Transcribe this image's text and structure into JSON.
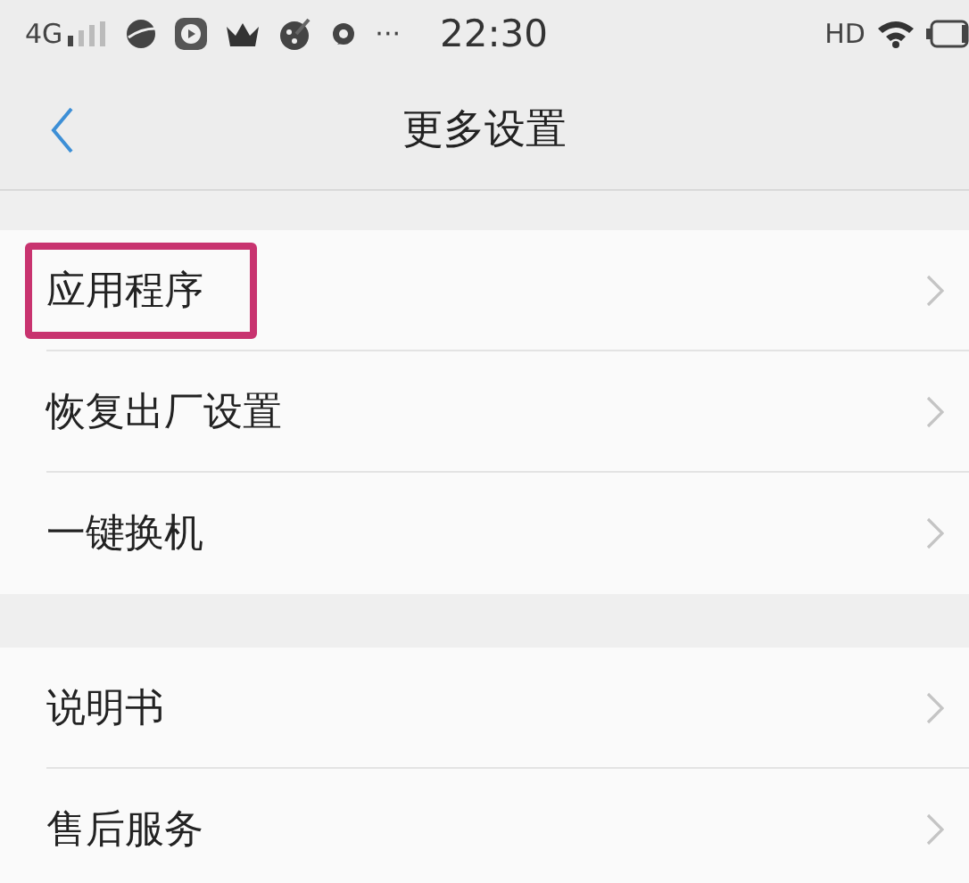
{
  "status_bar": {
    "network": "4G",
    "more": "···",
    "time": "22:30",
    "hd": "HD"
  },
  "header": {
    "title": "更多设置"
  },
  "sections": [
    {
      "items": [
        {
          "label": "应用程序",
          "highlighted": true
        },
        {
          "label": "恢复出厂设置",
          "highlighted": false
        },
        {
          "label": "一键换机",
          "highlighted": false
        }
      ]
    },
    {
      "items": [
        {
          "label": "说明书",
          "highlighted": false
        },
        {
          "label": "售后服务",
          "highlighted": false
        }
      ]
    }
  ]
}
